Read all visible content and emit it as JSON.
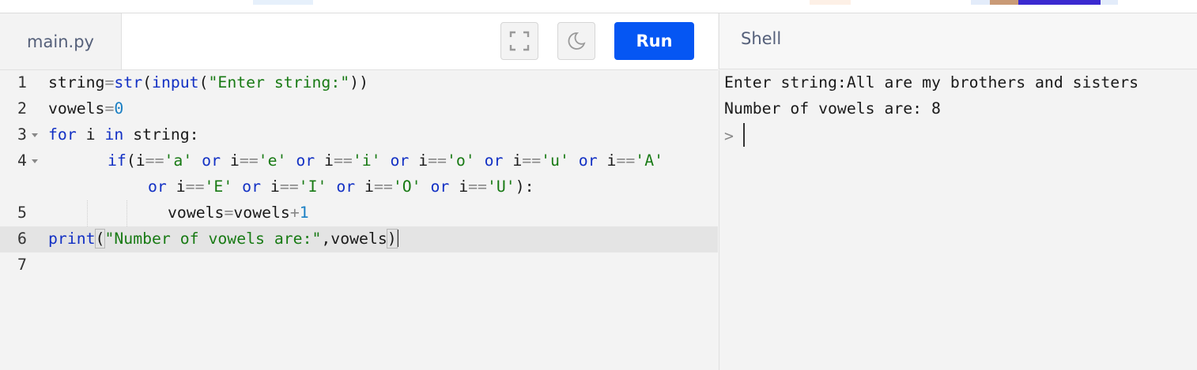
{
  "editor": {
    "tab_label": "main.py",
    "run_label": "Run",
    "fullscreen_icon": "fullscreen-icon",
    "theme_icon": "moon-icon"
  },
  "shell": {
    "tab_label": "Shell",
    "output": [
      "Enter string:All are my brothers and sisters",
      "Number of vowels are: 8"
    ],
    "prompt": ">"
  },
  "code": {
    "line_numbers": [
      "1",
      "2",
      "3",
      "4",
      "5",
      "6",
      "7"
    ],
    "lines": [
      "string=str(input(\"Enter string:\"))",
      "vowels=0",
      "for i in string:",
      "if(i=='a' or i=='e' or i=='i' or i=='o' or i=='u' or i=='A'",
      "or i=='E' or i=='I' or i=='O' or i=='U'):",
      "vowels=vowels+1",
      "print(\"Number of vowels are:\",vowels)"
    ]
  },
  "colors": {
    "run_button": "#0556f3",
    "keyword": "#1230c4",
    "string": "#187a14",
    "number": "#1a7fc4"
  }
}
